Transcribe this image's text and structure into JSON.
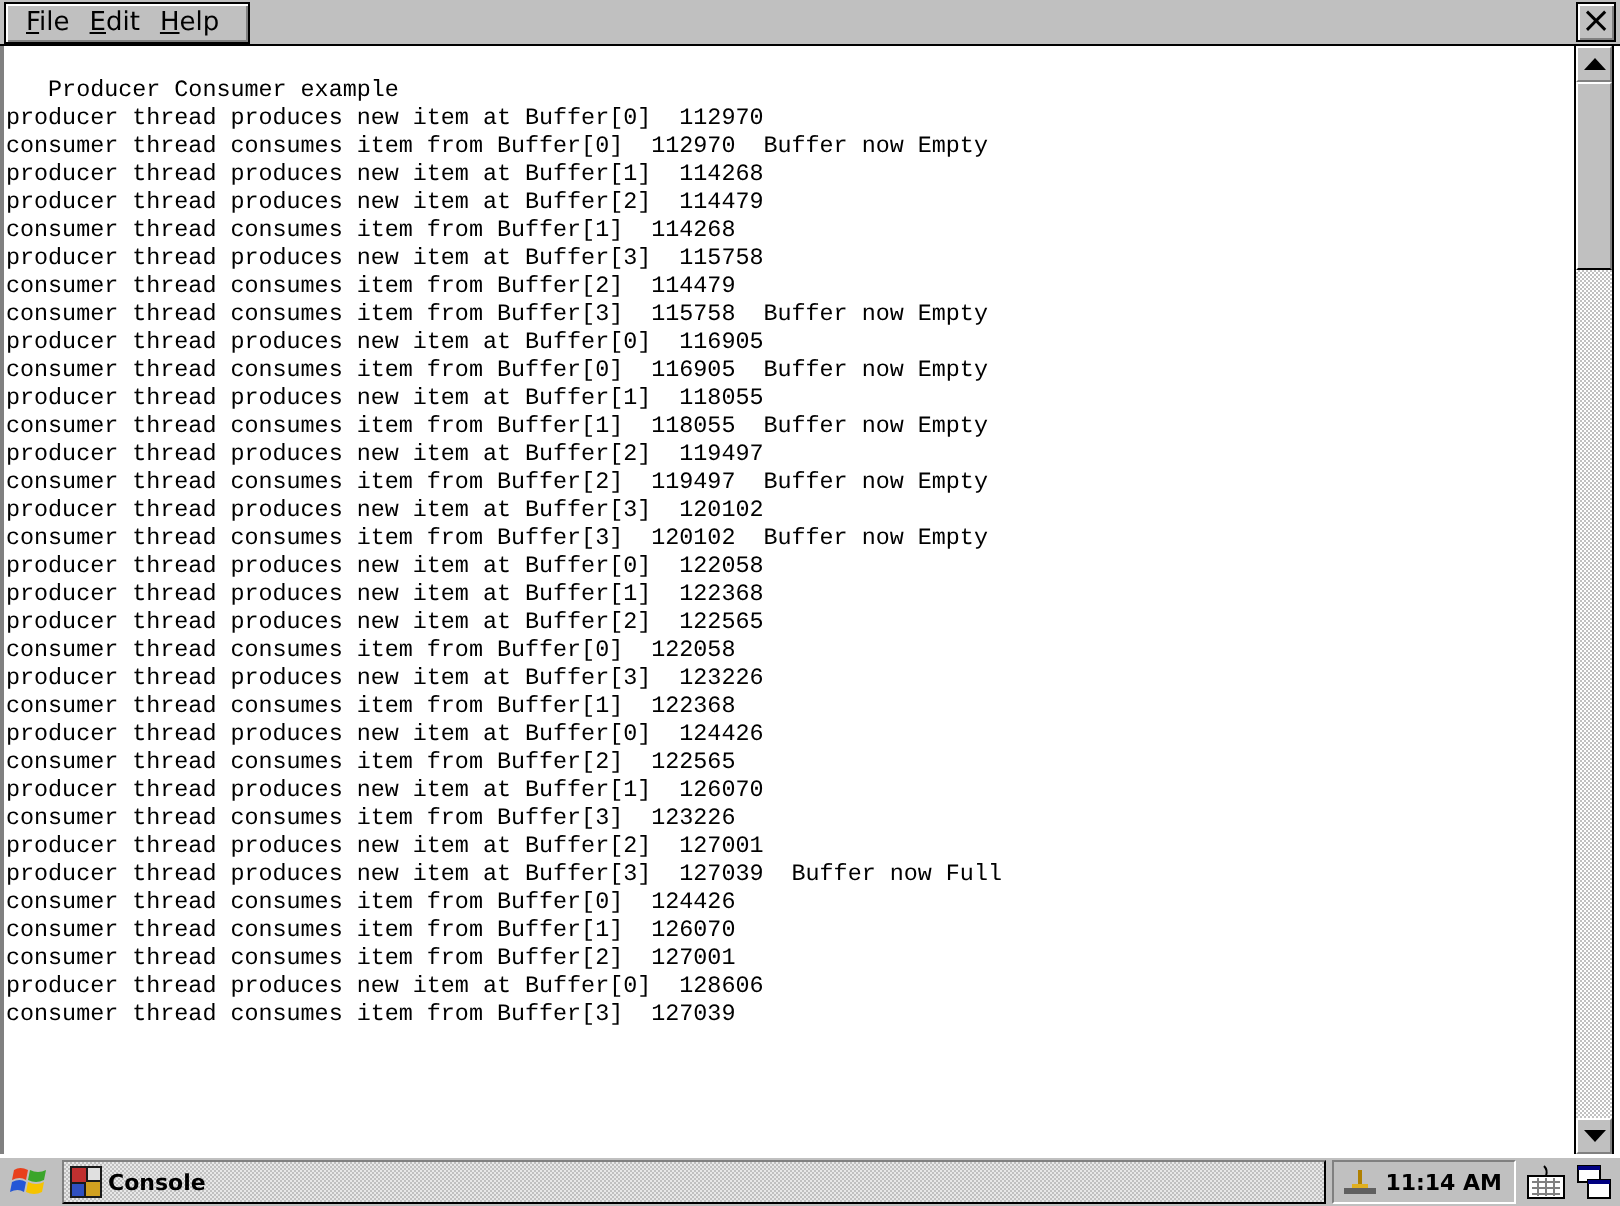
{
  "menu_bar": {
    "items": [
      {
        "label": "File"
      },
      {
        "label": "Edit"
      },
      {
        "label": "Help"
      }
    ],
    "close_button": "×"
  },
  "console": {
    "lines": [
      "   Producer Consumer example",
      "producer thread produces new item at Buffer[0]  112970",
      "consumer thread consumes item from Buffer[0]  112970  Buffer now Empty",
      "producer thread produces new item at Buffer[1]  114268",
      "producer thread produces new item at Buffer[2]  114479",
      "consumer thread consumes item from Buffer[1]  114268",
      "producer thread produces new item at Buffer[3]  115758",
      "consumer thread consumes item from Buffer[2]  114479",
      "consumer thread consumes item from Buffer[3]  115758  Buffer now Empty",
      "producer thread produces new item at Buffer[0]  116905",
      "consumer thread consumes item from Buffer[0]  116905  Buffer now Empty",
      "producer thread produces new item at Buffer[1]  118055",
      "consumer thread consumes item from Buffer[1]  118055  Buffer now Empty",
      "producer thread produces new item at Buffer[2]  119497",
      "consumer thread consumes item from Buffer[2]  119497  Buffer now Empty",
      "producer thread produces new item at Buffer[3]  120102",
      "consumer thread consumes item from Buffer[3]  120102  Buffer now Empty",
      "producer thread produces new item at Buffer[0]  122058",
      "producer thread produces new item at Buffer[1]  122368",
      "producer thread produces new item at Buffer[2]  122565",
      "consumer thread consumes item from Buffer[0]  122058",
      "producer thread produces new item at Buffer[3]  123226",
      "consumer thread consumes item from Buffer[1]  122368",
      "producer thread produces new item at Buffer[0]  124426",
      "consumer thread consumes item from Buffer[2]  122565",
      "producer thread produces new item at Buffer[1]  126070",
      "consumer thread consumes item from Buffer[3]  123226",
      "producer thread produces new item at Buffer[2]  127001",
      "producer thread produces new item at Buffer[3]  127039  Buffer now Full",
      "consumer thread consumes item from Buffer[0]  124426",
      "consumer thread consumes item from Buffer[1]  126070",
      "consumer thread consumes item from Buffer[2]  127001",
      "producer thread produces new item at Buffer[0]  128606",
      "consumer thread consumes item from Buffer[3]  127039"
    ]
  },
  "taskbar": {
    "task": {
      "label": "Console"
    },
    "clock": "11:14 AM"
  }
}
